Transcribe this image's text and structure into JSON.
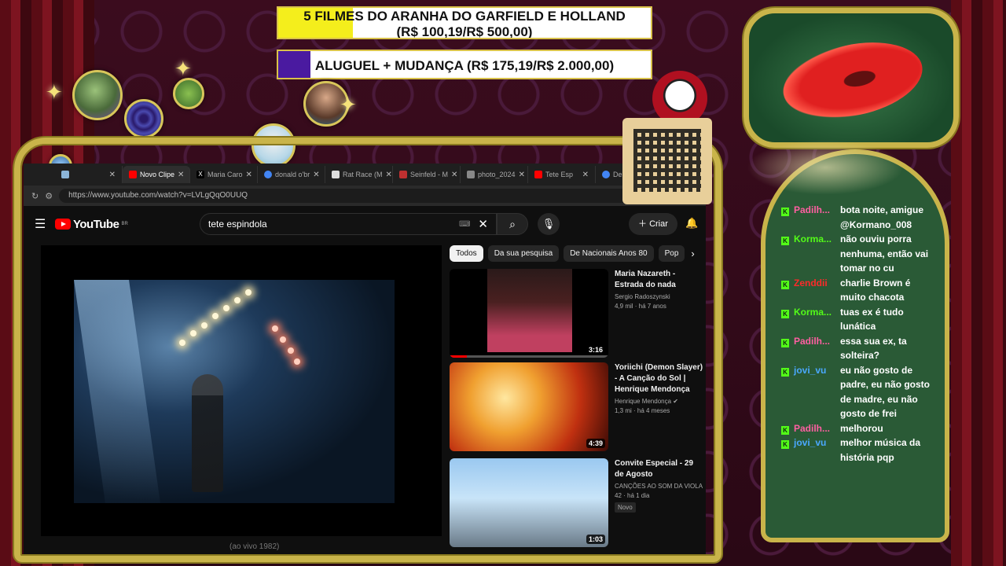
{
  "goals": [
    {
      "line1": "5 FILMES DO ARANHA DO GARFIELD E HOLLAND",
      "line2": "(R$ 100,19/R$ 500,00)",
      "progress": 0.2,
      "color": "#f4ee1c"
    },
    {
      "line1": "ALUGUEL + MUDANÇA (R$ 175,19/R$ 2.000,00)",
      "progress": 0.087,
      "color": "#4a1aa0"
    }
  ],
  "browser": {
    "tabs": [
      {
        "label": "",
        "icon": "globe-icon"
      },
      {
        "label": "Novo Clipe",
        "icon": "youtube-icon",
        "active": true
      },
      {
        "label": "Maria Caro",
        "icon": "x-icon"
      },
      {
        "label": "donald o'br",
        "icon": "chrome-icon"
      },
      {
        "label": "Rat Race (M",
        "icon": "wikipedia-icon"
      },
      {
        "label": "Seinfeld - M",
        "icon": "globe-icon"
      },
      {
        "label": "photo_2024",
        "icon": "globe-icon"
      },
      {
        "label": "Tete Esp",
        "icon": "youtube-icon"
      },
      {
        "label": "De niro espo",
        "icon": "chrome-icon"
      }
    ],
    "url": "https://www.youtube.com/watch?v=LVLgQqO0UUQ"
  },
  "youtube": {
    "logo_text": "YouTube",
    "country": "BR",
    "search_value": "tete espindola",
    "create_label": "Criar",
    "chips": [
      "Todos",
      "Da sua pesquisa",
      "De Nacionais Anos 80",
      "Pop"
    ],
    "below_text": "(ao vivo 1982)",
    "videos": [
      {
        "title": "Maria Nazareth - Estrada do nada",
        "channel": "Sergio Radoszynski",
        "views": "4,9 mil",
        "age": "há 7 anos",
        "duration": "3:16"
      },
      {
        "title": "Yoriichi (Demon Slayer) - A Canção do Sol | Henrique Mendonça",
        "channel": "Henrique Mendonça",
        "views": "1,3 mi",
        "age": "há 4 meses",
        "duration": "4:39"
      },
      {
        "title": "Convite Especial - 29 de Agosto",
        "channel": "CANÇÕES AO SOM DA VIOLA",
        "views": "42",
        "age": "há 1 dia",
        "duration": "1:03",
        "badge": "Novo"
      }
    ]
  },
  "chat": [
    {
      "user": "Padilh...",
      "color": "#ff5fa2",
      "text": "bota noite, amigue @Kormano_008"
    },
    {
      "user": "Korma...",
      "color": "#53fc18",
      "text": "não ouviu porra nenhuma, então vai tomar no cu"
    },
    {
      "user": "Zenddii",
      "color": "#ff2a2a",
      "text": "charlie Brown é muito chacota"
    },
    {
      "user": "Korma...",
      "color": "#53fc18",
      "text": "tuas ex é tudo lunática"
    },
    {
      "user": "Padilh...",
      "color": "#ff5fa2",
      "text": "essa sua ex, ta solteira?"
    },
    {
      "user": "jovi_vu",
      "color": "#4aa8ff",
      "text": "eu não gosto de padre, eu não gosto de madre, eu não gosto de frei"
    },
    {
      "user": "Padilh...",
      "color": "#ff5fa2",
      "text": "melhorou"
    },
    {
      "user": "jovi_vu",
      "color": "#4aa8ff",
      "text": "melhor música da história pqp"
    }
  ],
  "chat_badge": "K"
}
